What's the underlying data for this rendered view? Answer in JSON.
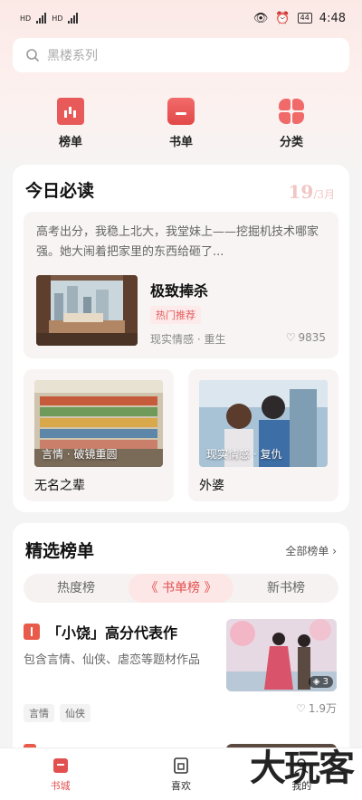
{
  "status_bar": {
    "time": "4:48",
    "battery": "44"
  },
  "search": {
    "placeholder": "黑楼系列"
  },
  "categories": [
    {
      "label": "榜单",
      "icon": "chart-icon"
    },
    {
      "label": "书单",
      "icon": "book-list-icon"
    },
    {
      "label": "分类",
      "icon": "grid-icon"
    }
  ],
  "today": {
    "title": "今日必读",
    "date_day": "19",
    "date_month": "/3月",
    "feature": {
      "blurb": "高考出分，我稳上北大，我堂妹上——挖掘机技术哪家强。她大闹着把家里的东西给砸了...",
      "title": "极致捧杀",
      "tag": "热门推荐",
      "genre": "现实情感 · 重生",
      "likes": "9835"
    },
    "books": [
      {
        "title": "无名之辈",
        "genre": "言情 · 破镜重圆"
      },
      {
        "title": "外婆",
        "genre": "现实情感 · 复仇"
      }
    ]
  },
  "ranking": {
    "title": "精选榜单",
    "more_label": "全部榜单",
    "tabs": [
      "热度榜",
      "书单榜",
      "新书榜"
    ],
    "active_tab": 1,
    "item": {
      "title": "「小饶」高分代表作",
      "desc": "包含言情、仙侠、虐恋等题材作品",
      "tags": [
        "言情",
        "仙侠"
      ],
      "cover_count": "3",
      "likes": "1.9万"
    }
  },
  "bottom_nav": [
    {
      "label": "书城",
      "active": true
    },
    {
      "label": "喜欢",
      "active": false
    },
    {
      "label": "我的",
      "active": false
    }
  ],
  "watermark": "大玩客",
  "colors": {
    "accent": "#e25050",
    "tag_bg": "#fdeaea"
  }
}
